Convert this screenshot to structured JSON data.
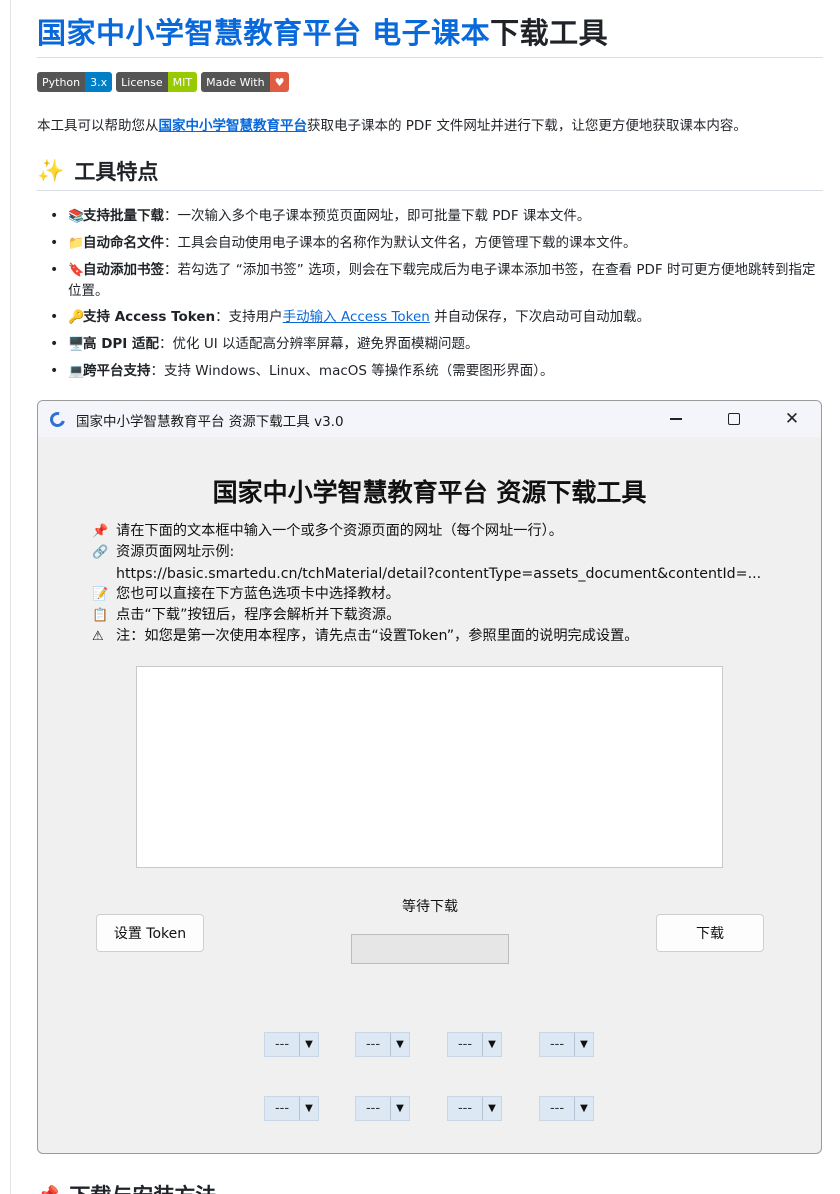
{
  "readme": {
    "title_blue": "国家中小学智慧教育平台 电子课本",
    "title_rest": "下载工具",
    "badges": [
      {
        "label": "Python",
        "value": "3.x",
        "color": "#007ec6"
      },
      {
        "label": "License",
        "value": "MIT",
        "color": "#97ca00"
      },
      {
        "label": "Made With",
        "value": "♥",
        "color": "#e05d44"
      }
    ],
    "intro": {
      "before": "本工具可以帮助您从",
      "link": "国家中小学智慧教育平台",
      "after": "获取电子课本的 PDF 文件网址并进行下载，让您更方便地获取课本内容。"
    },
    "features_heading": "工具特点",
    "features_icon": "sparkles-icon",
    "features": [
      {
        "icon": "books-icon",
        "glyph": "📚",
        "name": "支持批量下载",
        "text": "：一次输入多个电子课本预览页面网址，即可批量下载 PDF 课本文件。"
      },
      {
        "icon": "folder-icon",
        "glyph": "📁",
        "name": "自动命名文件",
        "text": "：工具会自动使用电子课本的名称作为默认文件名，方便管理下载的课本文件。"
      },
      {
        "icon": "bookmark-icon",
        "glyph": "🔖",
        "name": "自动添加书签",
        "text": "：若勾选了 “添加书签” 选项，则会在下载完成后为电子课本添加书签，在查看 PDF 时可更方便地跳转到指定位置。"
      },
      {
        "icon": "key-icon",
        "glyph": "🔑",
        "name": "支持 Access Token",
        "text_before": "：支持用户",
        "link": "手动输入 Access Token",
        "text_after": " 并自动保存，下次启动可自动加载。"
      },
      {
        "icon": "monitor-icon",
        "glyph": "🖥️",
        "name": "高 DPI 适配",
        "text": "：优化 UI 以适配高分辨率屏幕，避免界面模糊问题。"
      },
      {
        "icon": "laptop-icon",
        "glyph": "💻",
        "name": "跨平台支持",
        "text": "：支持 Windows、Linux、macOS 等操作系统（需要图形界面）。"
      }
    ],
    "next_heading": "下载与安装方法"
  },
  "window": {
    "title": "国家中小学智慧教育平台 资源下载工具 v3.0",
    "app_title": "国家中小学智慧教育平台 资源下载工具",
    "instructions": [
      {
        "icon": "pushpin-icon",
        "glyph": "📌",
        "text": "请在下面的文本框中输入一个或多个资源页面的网址（每个网址一行）。"
      },
      {
        "icon": "link-icon",
        "glyph": "🔗",
        "text": "资源页面网址示例:"
      },
      {
        "icon": "",
        "glyph": "",
        "text": "https://basic.smartedu.cn/tchMaterial/detail?contentType=assets_document&contentId=..."
      },
      {
        "icon": "memo-icon",
        "glyph": "📝",
        "text": "您也可以直接在下方蓝色选项卡中选择教材。"
      },
      {
        "icon": "clipboard-icon",
        "glyph": "📋",
        "text": "点击“下载”按钮后，程序会解析并下载资源。"
      },
      {
        "icon": "warning-icon",
        "glyph": "⚠",
        "text": "注：如您是第一次使用本程序，请先点击“设置Token”，参照里面的说明完成设置。"
      }
    ],
    "url_input_value": "",
    "status_text": "等待下载",
    "progress": 0,
    "token_button": "设置 Token",
    "download_button": "下载",
    "combos": [
      "---",
      "---",
      "---",
      "---",
      "---",
      "---",
      "---",
      "---"
    ]
  }
}
